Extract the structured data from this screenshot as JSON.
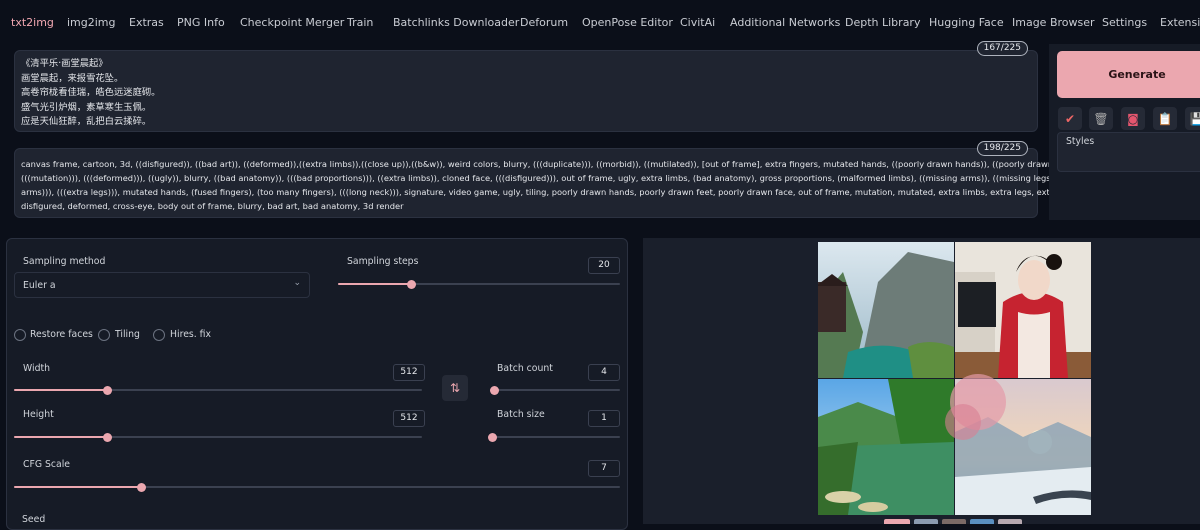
{
  "tabs": [
    {
      "label": "txt2img"
    },
    {
      "label": "img2img"
    },
    {
      "label": "Extras"
    },
    {
      "label": "PNG Info"
    },
    {
      "label": "Checkpoint Merger"
    },
    {
      "label": "Train"
    },
    {
      "label": "Batchlinks Downloader"
    },
    {
      "label": "Deforum"
    },
    {
      "label": "OpenPose Editor"
    },
    {
      "label": "CivitAi"
    },
    {
      "label": "Additional Networks"
    },
    {
      "label": "Depth Library"
    },
    {
      "label": "Hugging Face"
    },
    {
      "label": "Image Browser"
    },
    {
      "label": "Settings"
    },
    {
      "label": "Extensio"
    }
  ],
  "prompt": {
    "counter": "167/225",
    "lines": [
      "《清平乐·画堂晨起》",
      "画堂晨起，来报雪花坠。",
      "高卷帘栊看佳瑞，皓色远迷庭砌。",
      "盛气光引炉烟，素草寒生玉佩。",
      "应是天仙狂醉，乱把白云揉碎。"
    ]
  },
  "negative_prompt": {
    "counter": "198/225",
    "lines": [
      "canvas frame, cartoon, 3d, ((disfigured)), ((bad art)), ((deformed)),((extra limbs)),((close up)),((b&w)), weird colors, blurry, (((duplicate))), ((morbid)), ((mutilated)), [out of frame], extra fingers, mutated hands, ((poorly drawn hands)), ((poorly drawn face)),",
      "(((mutation))), (((deformed))), ((ugly)), blurry, ((bad anatomy)), (((bad proportions))), ((extra limbs)), cloned face, (((disfigured))), out of frame, ugly, extra limbs, (bad anatomy), gross proportions, (malformed limbs), ((missing arms)), ((missing legs)), (((extra",
      "arms))), (((extra legs))), mutated hands, (fused fingers), (too many fingers), (((long neck))), signature, video game, ugly, tiling, poorly drawn hands, poorly drawn feet, poorly drawn face, out of frame, mutation, mutated, extra limbs, extra legs, extra arms,",
      "disfigured, deformed, cross-eye, body out of frame, blurry, bad art, bad anatomy, 3d render"
    ]
  },
  "generate_label": "Generate",
  "styles_label": "Styles",
  "tools": {
    "icons": [
      "check-icon",
      "trash-icon",
      "save-style-icon",
      "clipboard-icon",
      "floppy-icon"
    ],
    "glyphs": [
      "✔",
      "🗑",
      "◙",
      "📋",
      "💾"
    ]
  },
  "settings": {
    "sampling_method": {
      "label": "Sampling method",
      "value": "Euler a"
    },
    "sampling_steps": {
      "label": "Sampling steps",
      "value": "20",
      "fraction": 0.26
    },
    "restore_faces": "Restore faces",
    "tiling": "Tiling",
    "hires_fix": "Hires. fix",
    "width": {
      "label": "Width",
      "value": "512",
      "fraction": 0.23
    },
    "height": {
      "label": "Height",
      "value": "512",
      "fraction": 0.23
    },
    "batch_count": {
      "label": "Batch count",
      "value": "4",
      "fraction": 0.02
    },
    "batch_size": {
      "label": "Batch size",
      "value": "1",
      "fraction": 0.0
    },
    "cfg_scale": {
      "label": "CFG Scale",
      "value": "7",
      "fraction": 0.21
    },
    "seed_label": "Seed"
  },
  "colors": {
    "accent": "#eba7af",
    "background": "#0b0f19",
    "panel": "#1f2430"
  }
}
